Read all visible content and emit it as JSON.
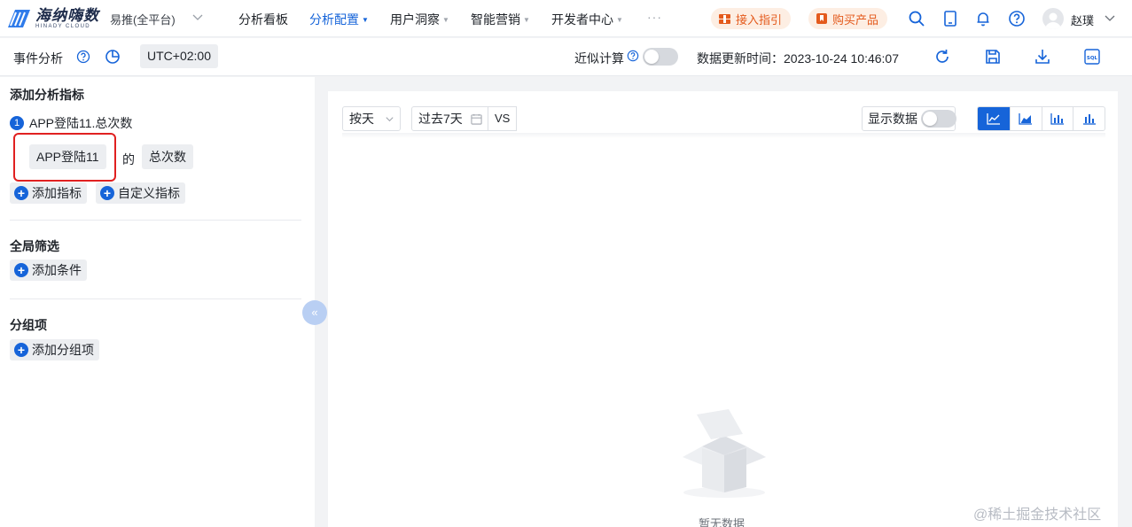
{
  "brand": {
    "name_cn": "海纳嗨数",
    "name_en": "HINADY CLOUD"
  },
  "project": "易推(全平台)",
  "nav": [
    {
      "label": "分析看板",
      "has_caret": false,
      "active": false
    },
    {
      "label": "分析配置",
      "has_caret": true,
      "active": true
    },
    {
      "label": "用户洞察",
      "has_caret": true,
      "active": false
    },
    {
      "label": "智能营销",
      "has_caret": true,
      "active": false
    },
    {
      "label": "开发者中心",
      "has_caret": true,
      "active": false
    }
  ],
  "more": "···",
  "actions": {
    "guide": "接入指引",
    "buy": "购买产品"
  },
  "user": {
    "name": "赵璞"
  },
  "toolbar": {
    "title": "事件分析",
    "timezone": "UTC+02:00",
    "approx_label": "近似计算",
    "approx_on": false,
    "updated_label": "数据更新时间：2023-10-24 10:46:07"
  },
  "left": {
    "metrics_title": "添加分析指标",
    "metric": {
      "index": "1",
      "label": "APP登陆11.总次数",
      "event": "APP登陆11",
      "of": "的",
      "agg": "总次数"
    },
    "add_metric": "添加指标",
    "custom_metric": "自定义指标",
    "filter_title": "全局筛选",
    "add_condition": "添加条件",
    "group_title": "分组项",
    "add_group": "添加分组项"
  },
  "main": {
    "granularity": "按天",
    "range": "过去7天",
    "vs": "VS",
    "show_data_label": "显示数据",
    "show_data_on": false,
    "chart_type_active": "line",
    "empty_text": "暂无数据"
  },
  "watermark": "@稀土掘金技术社区",
  "colors": {
    "accent": "#1664d9",
    "warn_bg": "#fdeee3",
    "warn_text": "#e45a1c",
    "highlight": "#e02020"
  }
}
